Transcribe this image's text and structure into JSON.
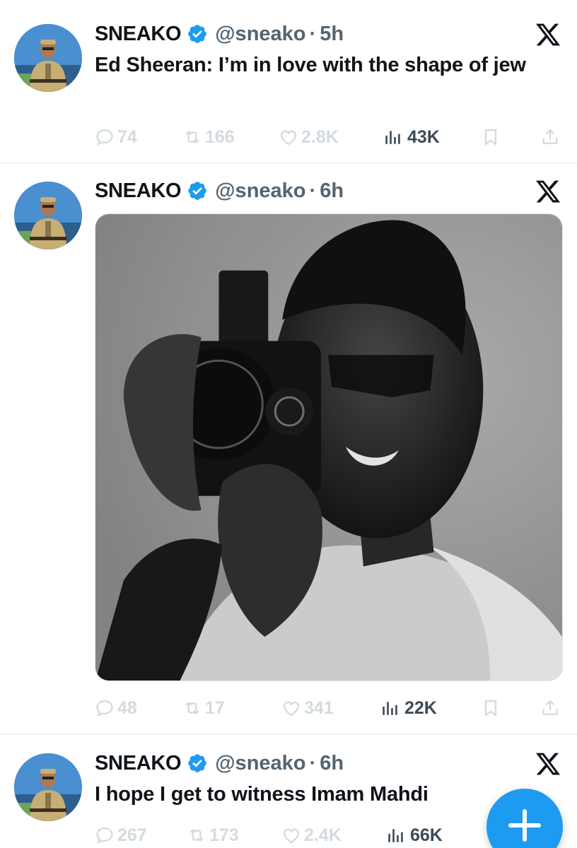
{
  "tweets": [
    {
      "name": "SNEAKO",
      "handle": "@sneako",
      "separator": "·",
      "time": "5h",
      "text": "Ed Sheeran: I’m in love with the shape of jew",
      "replies": "74",
      "retweets": "166",
      "likes": "2.8K",
      "views": "43K",
      "icons": [
        "verified-badge",
        "x-logo",
        "reply-icon",
        "retweet-icon",
        "like-icon",
        "views-icon",
        "bookmark-icon",
        "share-icon"
      ]
    },
    {
      "name": "SNEAKO",
      "handle": "@sneako",
      "separator": "·",
      "time": "6h",
      "text": "",
      "has_media": true,
      "media_description_icon": "photo",
      "replies": "48",
      "retweets": "17",
      "likes": "341",
      "views": "22K"
    },
    {
      "name": "SNEAKO",
      "handle": "@sneako",
      "separator": "·",
      "time": "6h",
      "text": "I hope I get to witness Imam Mahdi",
      "replies": "267",
      "retweets": "173",
      "likes": "2.4K",
      "views": "66K"
    }
  ],
  "compose_button": {
    "icon": "plus-icon"
  },
  "colors": {
    "accent": "#1d9bf0",
    "text_primary": "#0f1419",
    "text_secondary": "#536471",
    "action_faded": "#d3dbe0",
    "divider": "#eff3f4"
  }
}
